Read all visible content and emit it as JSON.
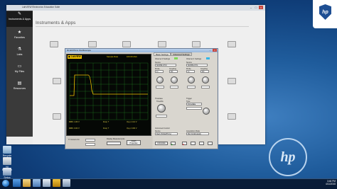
{
  "window": {
    "title": "LabVIEW Electronics Education Suite"
  },
  "sidebar": {
    "items": [
      {
        "label": "Instruments & Apps",
        "icon": "pencil-icon",
        "active": true
      },
      {
        "label": "Favorites",
        "icon": "star-icon"
      },
      {
        "label": "Labs",
        "icon": "lab-icon"
      },
      {
        "label": "My Files",
        "icon": "folder-icon"
      },
      {
        "label": "Resources",
        "icon": "book-icon"
      }
    ]
  },
  "main": {
    "title": "Instruments & Apps"
  },
  "oscilloscope": {
    "title": "NI ELVISmx Oscilloscope",
    "labview": "LabVIEW",
    "sample_rate": "Sample Rate",
    "sample_rate_value": "100.00 kS/s",
    "tabs": [
      "Basic Settings",
      "Advanced Settings"
    ],
    "ch0_label": "Channel 0 Settings",
    "ch1_label": "Channel 1 Settings",
    "source_label": "Source",
    "source_ch0": "SCOPE CH 0",
    "source_ch1": "SCOPE CH 1",
    "probe_label": "Probe",
    "probe_value": "1x",
    "coupling_label": "Coupling",
    "coupling_value": "DC",
    "scale_label": "Scale Volts/Div",
    "vertical_label": "Vertical Position (Div)",
    "timebase_label": "Timebase",
    "time_div_label": "Time/Div",
    "trigger_label": "Trigger",
    "type_label": "Type",
    "type_value": "Immediate",
    "instrument_control": "Instrument Control",
    "device_label": "Device",
    "device_value": "Dev1 (NI ELVIS II+)",
    "acq_mode_label": "Acquisition Mode",
    "acq_mode_value": "Run Continuously",
    "autoscale": "Autoscale",
    "cursors_label": "Cursors On",
    "display_measurements": "Display Measurements",
    "graph_properties": "Graph Properties",
    "meas": {
      "ch0_rms": "RMS: 1.06 V",
      "ch0_freq": "Freq: ?",
      "ch0_vpp": "Vp-p: 2.12 V",
      "ch1_rms": "RMS: 0.00 V",
      "ch1_freq": "Freq: ?",
      "ch1_vpp": "Vp-p: 0.00 V"
    }
  },
  "desktop": {
    "icons": [
      {
        "label": "Recycle Bin",
        "icon": "recycle-bin-icon"
      },
      {
        "label": "NI ELVISmx",
        "icon": "elvis-icon"
      },
      {
        "label": "Setup",
        "icon": "setup-icon"
      }
    ]
  },
  "taskbar": {
    "time": "3:46 PM",
    "date": "4/11/2015"
  },
  "colors": {
    "desktop": "#1f5c9c",
    "sidebar": "#3a3a3a",
    "trace_ch0": "#f2c300",
    "grid": "#1e7a1e"
  }
}
